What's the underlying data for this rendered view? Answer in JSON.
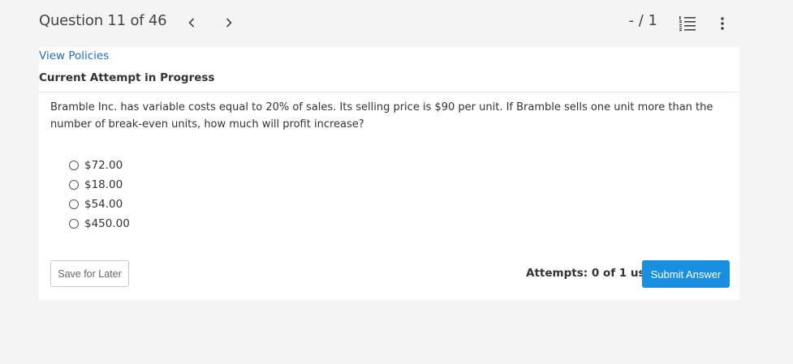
{
  "header": {
    "question_counter": "Question 11 of 46",
    "score": "- / 1",
    "icons": {
      "prev": "chevron-left-icon",
      "next": "chevron-right-icon",
      "list": "numbered-list-icon",
      "more": "more-vertical-icon"
    }
  },
  "policies": {
    "link_label": "View Policies"
  },
  "attempt_status": "Current Attempt in Progress",
  "question": {
    "text": "Bramble Inc. has variable costs equal to 20% of sales. Its selling price is $90 per unit. If Bramble sells one unit more than the number of break-even units, how much will profit increase?",
    "options": [
      {
        "label": "$72.00",
        "selected": false
      },
      {
        "label": "$18.00",
        "selected": false
      },
      {
        "label": "$54.00",
        "selected": false
      },
      {
        "label": "$450.00",
        "selected": false
      }
    ]
  },
  "footer": {
    "save_label": "Save for Later",
    "attempts_label": "Attempts: 0 of 1 used",
    "submit_label": "Submit Answer"
  },
  "colors": {
    "accent": "#1a8fe0",
    "link": "#1f6fc4",
    "page_background": "#f4f4f4",
    "panel_background": "#ffffff"
  }
}
